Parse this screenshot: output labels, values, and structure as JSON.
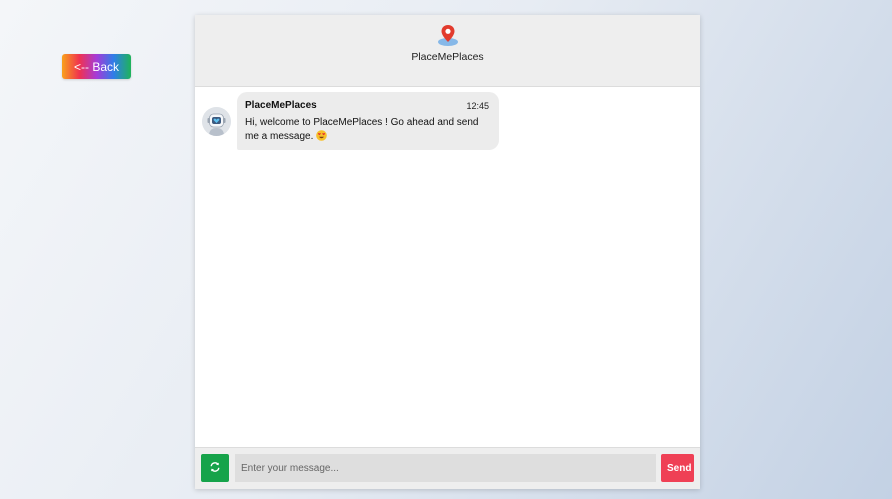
{
  "back_button": {
    "label": "<-- Back"
  },
  "header": {
    "title": "PlaceMePlaces",
    "logo_icon": "map-pin-icon"
  },
  "messages": [
    {
      "sender": "PlaceMePlaces",
      "time": "12:45",
      "text": "Hi, welcome to PlaceMePlaces ! Go ahead and send me a message.",
      "emoji_icon": "smiling-face-with-heart-eyes-icon",
      "avatar_icon": "robot-avatar-icon"
    }
  ],
  "input_bar": {
    "refresh_icon": "refresh-icon",
    "placeholder": "Enter your message...",
    "send_label": "Send"
  },
  "colors": {
    "refresh_button": "#16a34a",
    "send_button": "#ef4055",
    "header_bg": "#eeeeee",
    "bubble_bg": "#ececec"
  }
}
